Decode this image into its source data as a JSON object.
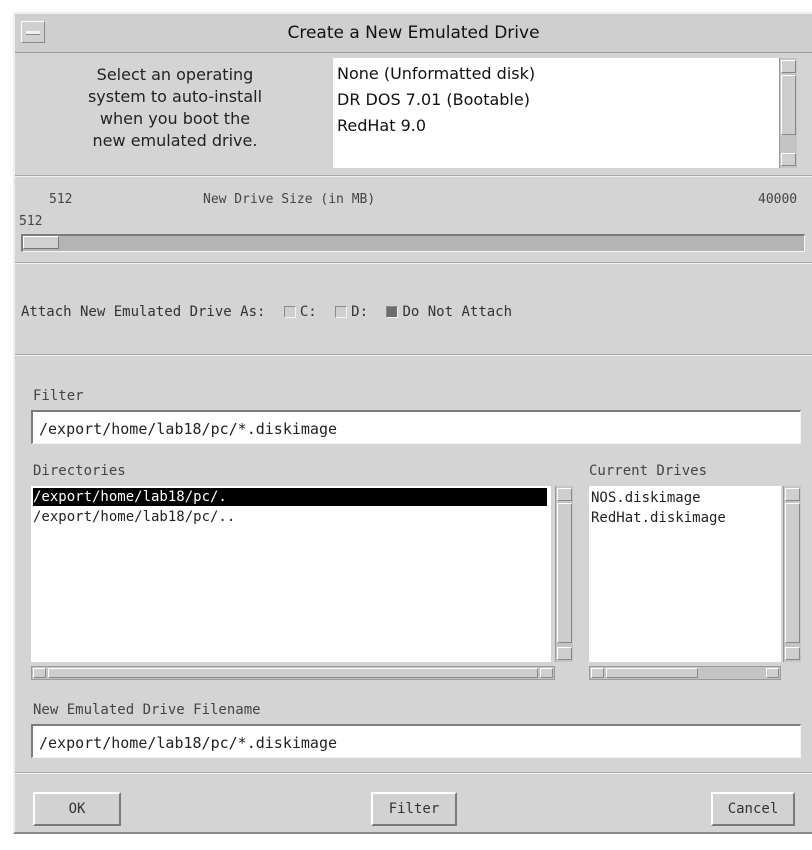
{
  "window": {
    "title": "Create a New Emulated Drive"
  },
  "os_section": {
    "instructions": [
      "Select an operating",
      "system to auto-install",
      "when you boot the",
      "new emulated drive."
    ],
    "options": [
      "None (Unformatted disk)",
      "DR DOS 7.01 (Bootable)",
      "RedHat 9.0"
    ]
  },
  "size": {
    "min_label": "512",
    "title": "New Drive Size (in MB)",
    "max_label": "40000",
    "current_value": "512",
    "slider_fraction": 0.0
  },
  "attach": {
    "label": "Attach New Emulated Drive As:",
    "options": [
      {
        "label": "C:",
        "selected": false
      },
      {
        "label": "D:",
        "selected": false
      },
      {
        "label": "Do Not Attach",
        "selected": true
      }
    ]
  },
  "filter": {
    "label": "Filter",
    "value": "/export/home/lab18/pc/*.diskimage"
  },
  "directories": {
    "label": "Directories",
    "items": [
      "/export/home/lab18/pc/.",
      "/export/home/lab18/pc/.."
    ],
    "selected_index": 0
  },
  "current_drives": {
    "label": "Current Drives",
    "items": [
      "NOS.diskimage",
      "RedHat.diskimage"
    ]
  },
  "filename": {
    "label": "New Emulated Drive Filename",
    "value": "/export/home/lab18/pc/*.diskimage"
  },
  "buttons": {
    "ok": "OK",
    "filter": "Filter",
    "cancel": "Cancel"
  }
}
